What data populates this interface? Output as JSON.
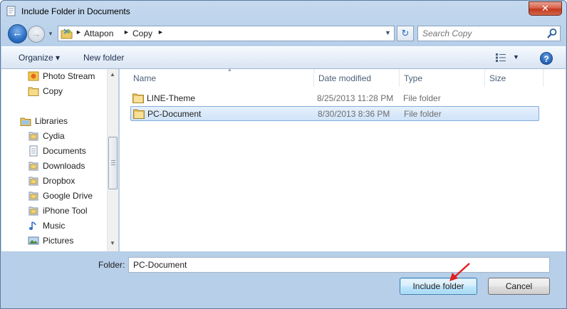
{
  "window": {
    "title": "Include Folder in Documents",
    "close_label": "✕"
  },
  "navigation": {
    "back_glyph": "←",
    "forward_glyph": "→",
    "recent_glyph": "▾",
    "breadcrumbs": [
      "Attapon",
      "Copy"
    ],
    "separator": "►",
    "address_dropdown": "▼",
    "refresh_glyph": "↻"
  },
  "search": {
    "placeholder": "Search Copy"
  },
  "toolbar": {
    "organize_label": "Organize ▾",
    "new_folder_label": "New folder",
    "view_dropdown": "▼",
    "help_label": "?"
  },
  "sidebar": {
    "items": [
      {
        "label": "Photo Stream",
        "icon": "photo-stream-icon"
      },
      {
        "label": "Copy",
        "icon": "folder-icon"
      },
      {
        "label": "Libraries",
        "icon": "libraries-icon"
      },
      {
        "label": "Cydia",
        "icon": "library-icon"
      },
      {
        "label": "Documents",
        "icon": "documents-library-icon"
      },
      {
        "label": "Downloads",
        "icon": "library-icon"
      },
      {
        "label": "Dropbox",
        "icon": "library-icon"
      },
      {
        "label": "Google Drive",
        "icon": "library-icon"
      },
      {
        "label": "iPhone Tool",
        "icon": "library-icon"
      },
      {
        "label": "Music",
        "icon": "music-library-icon"
      },
      {
        "label": "Pictures",
        "icon": "pictures-library-icon"
      }
    ],
    "scroll_up": "▲",
    "scroll_down": "▼"
  },
  "file_list": {
    "columns": [
      "Name",
      "Date modified",
      "Type",
      "Size"
    ],
    "sort_indicator": "▲",
    "rows": [
      {
        "name": "LINE-Theme",
        "date": "8/25/2013 11:28 PM",
        "type": "File folder",
        "selected": false
      },
      {
        "name": "PC-Document",
        "date": "8/30/2013 8:36 PM",
        "type": "File folder",
        "selected": true
      }
    ]
  },
  "footer": {
    "folder_label": "Folder:",
    "folder_value": "PC-Document",
    "include_button": "Include folder",
    "cancel_button": "Cancel"
  },
  "colors": {
    "selection": "#cfe3f9",
    "accent": "#2b6ec5",
    "annotation_arrow": "#e02020"
  }
}
